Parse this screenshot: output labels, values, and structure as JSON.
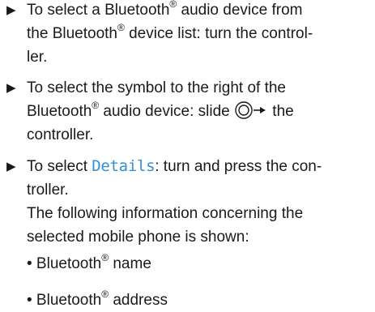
{
  "step1": {
    "arrow": "▶",
    "line1_a": "To select a Bluetooth",
    "reg_mark": "®",
    "line1_b": " audio device from",
    "line2_a": "the Bluetooth",
    "line2_b": " device list: turn the control-",
    "line3": "ler."
  },
  "step2": {
    "arrow": "▶",
    "line1": "To select the symbol to the right of the",
    "line2_a": "Bluetooth",
    "line2_b": " audio device: slide ",
    "line2_c": " the",
    "line3": "controller.",
    "controller_icon": "controller-slide-right-icon"
  },
  "step3": {
    "arrow": "▶",
    "line1_a": "To select ",
    "details_label": "Details",
    "line1_b": ": turn and press the con-",
    "line2": "troller.",
    "line3": "The following information concerning the",
    "line4": "selected mobile phone is shown:"
  },
  "bullets": [
    {
      "marker": "•",
      "text_a": " Bluetooth",
      "text_b": " name"
    },
    {
      "marker": "•",
      "text_a": " Bluetooth",
      "text_b": " address"
    }
  ],
  "colors": {
    "display_text": "#2f90d8",
    "body_text": "#1a1a1a"
  }
}
